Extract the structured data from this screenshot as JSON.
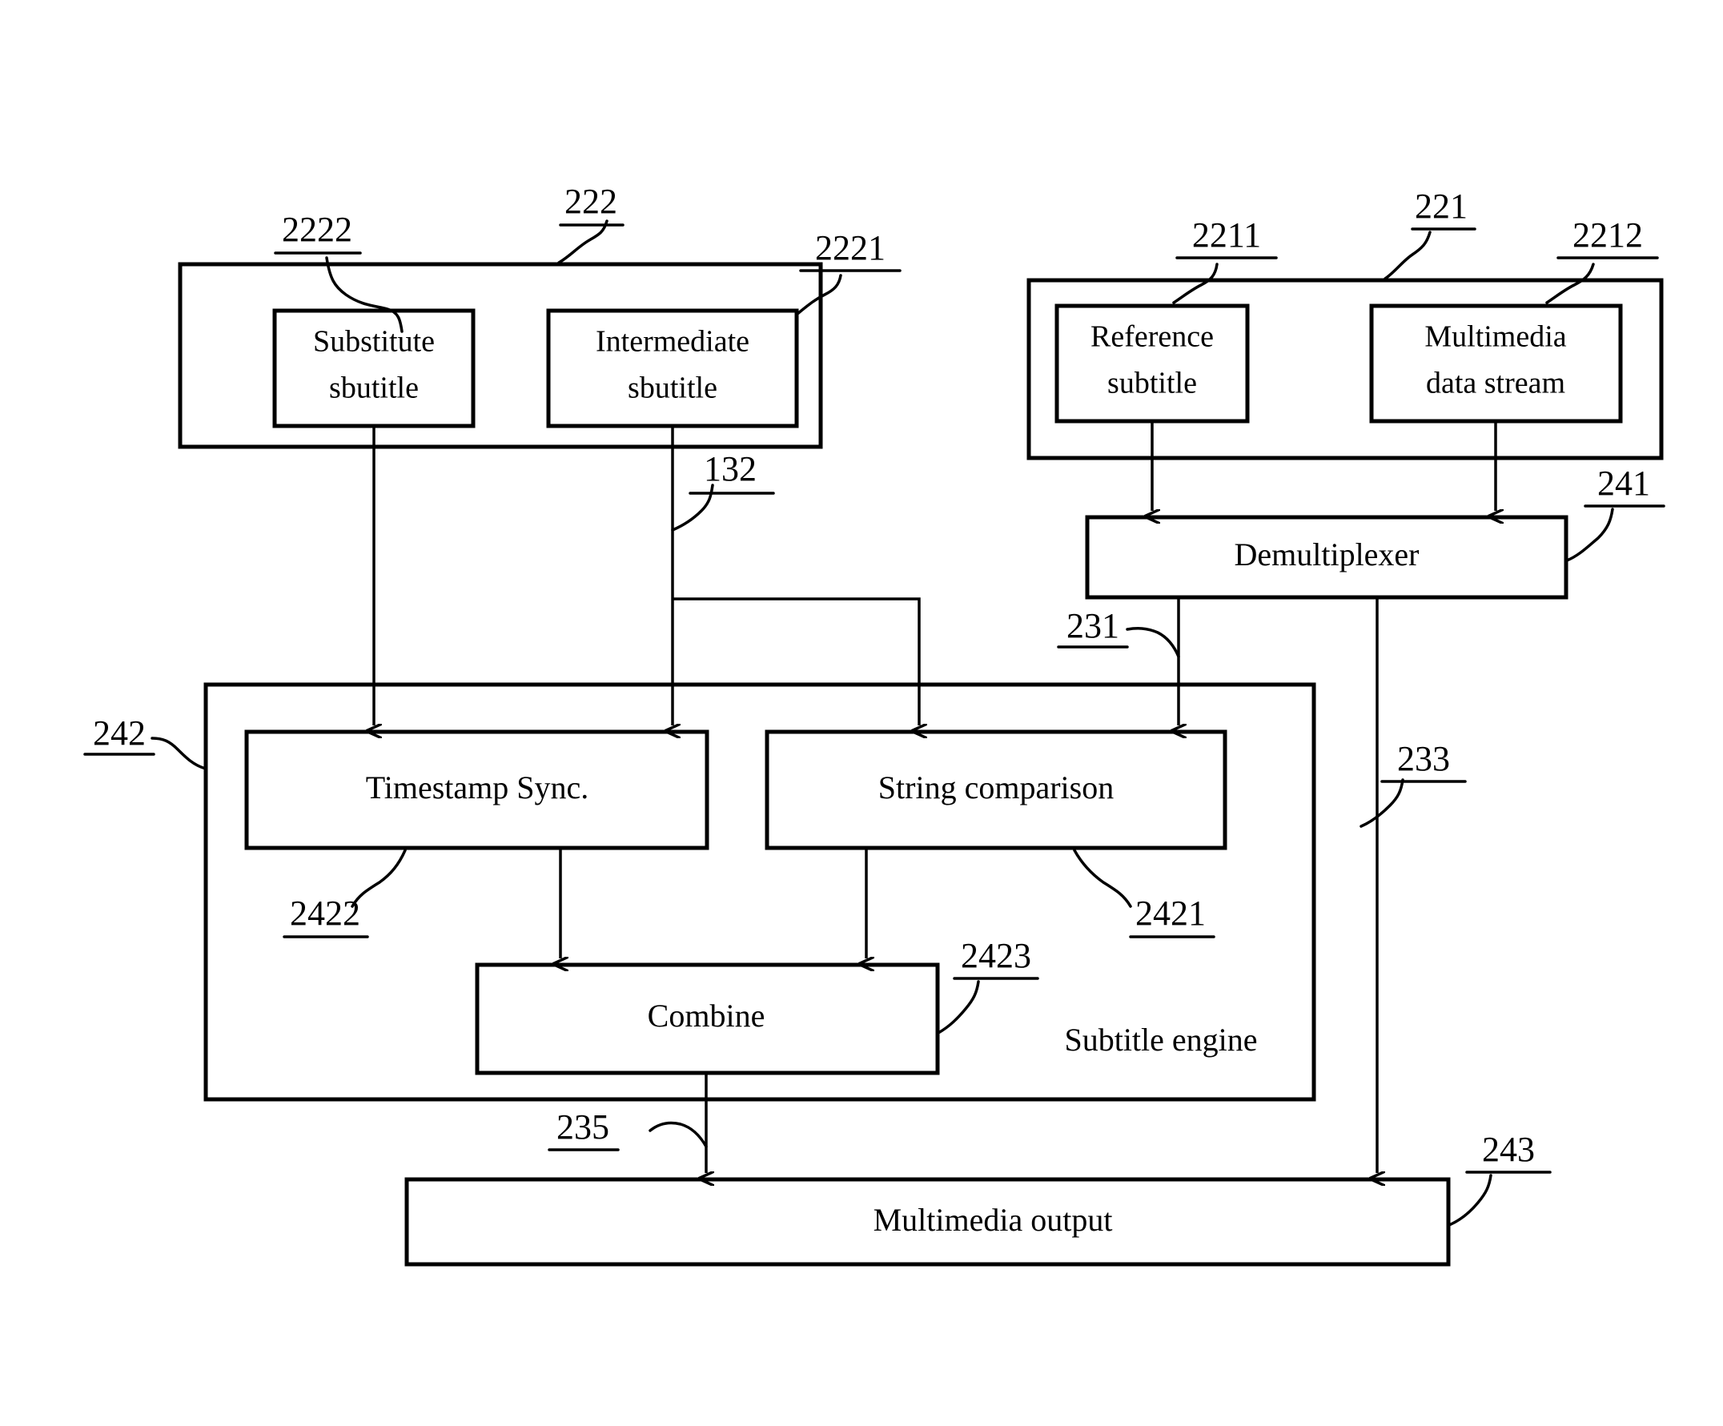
{
  "figure": {
    "kind": "patent-block-diagram",
    "background_color": "#ffffff",
    "line_color": "#000000"
  },
  "groups": {
    "substitute_group": {
      "ref": "222",
      "ref_2222": "2222",
      "ref_2221": "2221"
    },
    "source_group": {
      "ref": "221",
      "ref_2211": "2211",
      "ref_2212": "2212"
    },
    "subtitle_engine": {
      "ref": "242",
      "label": "Subtitle engine"
    }
  },
  "blocks": {
    "substitute_subtitle": {
      "line1": "Substitute",
      "line2": "sbutitle"
    },
    "intermediate_subtitle": {
      "line1": "Intermediate",
      "line2": "sbutitle"
    },
    "reference_subtitle": {
      "line1": "Reference",
      "line2": "subtitle"
    },
    "multimedia_data_stream": {
      "line1": "Multimedia",
      "line2": "data stream"
    },
    "demultiplexer": {
      "label": "Demultiplexer",
      "ref": "241"
    },
    "timestamp_sync": {
      "label": "Timestamp Sync.",
      "ref": "2422"
    },
    "string_comparison": {
      "label": "String comparison",
      "ref": "2421"
    },
    "combine": {
      "label": "Combine",
      "ref": "2423"
    },
    "multimedia_output": {
      "label": "Multimedia output",
      "ref": "243"
    }
  },
  "signals": {
    "intermediate_branch": "132",
    "demux_subtitle_out": "231",
    "demux_stream_out": "233",
    "combine_out": "235"
  }
}
